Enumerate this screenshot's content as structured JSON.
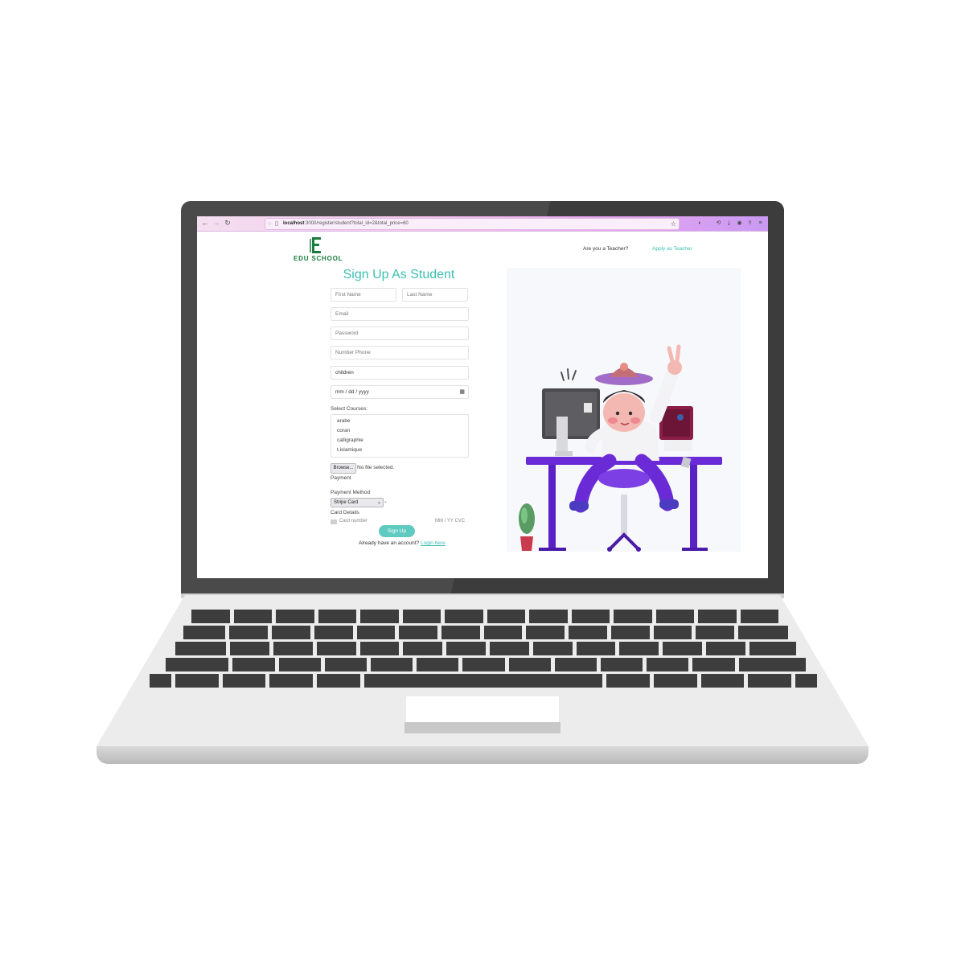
{
  "browser": {
    "url_host": "localhost",
    "url_rest": ":3000/register/student?total_id=2&total_price=60"
  },
  "header": {
    "logo_text": "EDU SCHOOL",
    "teacher_question": "Are you a Teacher?",
    "teacher_link": "Apply as Teacher"
  },
  "form": {
    "title": "Sign Up As Student",
    "first_name_placeholder": "First Name",
    "last_name_placeholder": "Last Name",
    "email_placeholder": "Email",
    "password_placeholder": "Password",
    "phone_placeholder": "Number Phone",
    "category_value": "children",
    "date_placeholder": "mm / dd / yyyy",
    "courses_label": "Select Courses:",
    "courses": [
      "arabe",
      "coran",
      "calligraphie",
      "t.islamique"
    ],
    "browse_label": "Browse...",
    "file_status": "No file selected.",
    "payment_label": "Payment",
    "payment_method_label": "Payment Method",
    "payment_method_value": "Stripe Card",
    "card_details_label": "Card Details",
    "card_number_placeholder": "Card number",
    "card_expiry_cvc": "MM / YY  CVC",
    "submit_label": "Sign Up",
    "already_text": "Already have an account?",
    "login_link": "Login here"
  },
  "colors": {
    "accent": "#3bbfb0",
    "logo_green": "#1a7c3e",
    "desk_purple": "#6a2bd6"
  }
}
